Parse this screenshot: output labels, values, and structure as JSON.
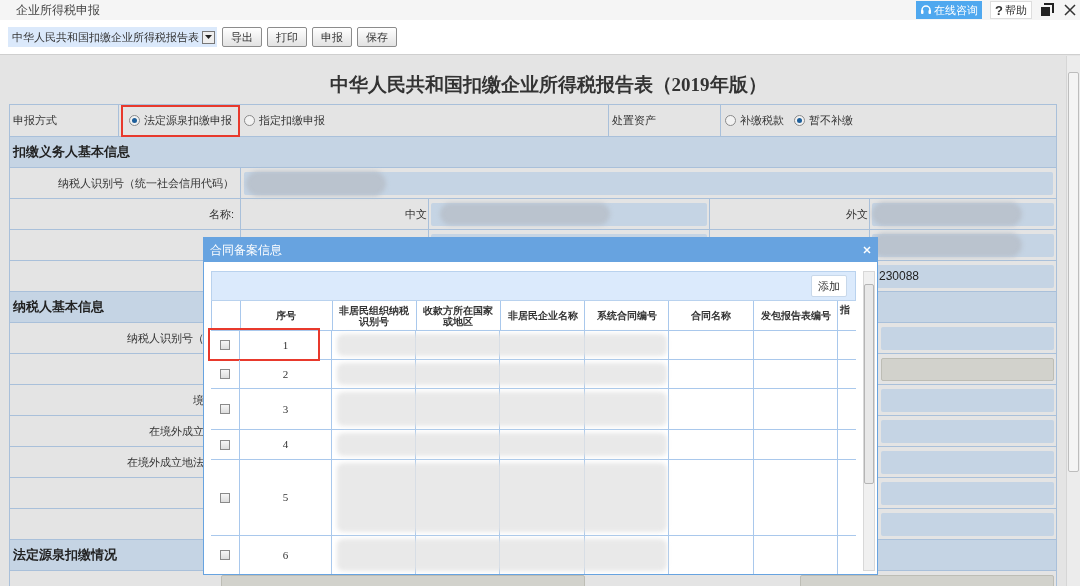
{
  "window": {
    "title": "企业所得税申报",
    "consult_button": "在线咨询",
    "help_icon": "?",
    "help_button": "帮助"
  },
  "toolbar": {
    "report_select": "中华人民共和国扣缴企业所得税报告表",
    "buttons": [
      "导出",
      "打印",
      "申报",
      "保存"
    ]
  },
  "form": {
    "title": "中华人民共和国扣缴企业所得税报告表（2019年版）",
    "declare_method": {
      "label": "申报方式",
      "options": [
        {
          "label": "法定源泉扣缴申报",
          "selected": true,
          "annotated": true
        },
        {
          "label": "指定扣缴申报",
          "selected": false,
          "annotated": false
        }
      ]
    },
    "asset_disposal": {
      "label": "处置资产",
      "options": [
        {
          "label": "补缴税款",
          "selected": false
        },
        {
          "label": "暂不补缴",
          "selected": true
        }
      ]
    },
    "sections": [
      {
        "title": "扣缴义务人基本信息",
        "rows": [
          {
            "kind": "full",
            "label": "纳税人识别号（统一社会信用代码）"
          },
          {
            "kind": "name",
            "label": "名称:",
            "chinese_label": "中文",
            "foreign_label": "外文"
          },
          {
            "kind": "name"
          },
          {
            "kind": "value",
            "value": "230088"
          }
        ]
      },
      {
        "title": "纳税人基本信息",
        "rows": [
          {
            "kind": "cut",
            "label": "纳税人识别号（",
            "disabled": false
          },
          {
            "kind": "cut",
            "disabled": true
          },
          {
            "kind": "cut",
            "label": "境",
            "disabled": false
          },
          {
            "kind": "cut",
            "label": "在境外成立",
            "disabled": false
          },
          {
            "kind": "cut",
            "label": "在境外成立地法",
            "disabled": false
          },
          {
            "kind": "cut",
            "disabled": false
          },
          {
            "kind": "cut",
            "disabled": false
          }
        ]
      },
      {
        "title": "法定源泉扣缴情况",
        "rows": [
          {
            "kind": "bottom"
          }
        ]
      }
    ]
  },
  "dialog": {
    "title": "合同备案信息",
    "add_button": "添加",
    "columns": [
      "序号",
      "非居民组织纳税识别号",
      "收款方所在国家或地区",
      "非居民企业名称",
      "系统合同编号",
      "合同名称",
      "发包报告表编号",
      "指"
    ],
    "rows": [
      {
        "index": "1",
        "checked": false,
        "annotated": true
      },
      {
        "index": "2",
        "checked": false,
        "annotated": false
      },
      {
        "index": "3",
        "checked": false,
        "annotated": false
      },
      {
        "index": "4",
        "checked": false,
        "annotated": false
      },
      {
        "index": "5",
        "checked": false,
        "annotated": false
      },
      {
        "index": "6",
        "checked": false,
        "annotated": false
      }
    ]
  }
}
